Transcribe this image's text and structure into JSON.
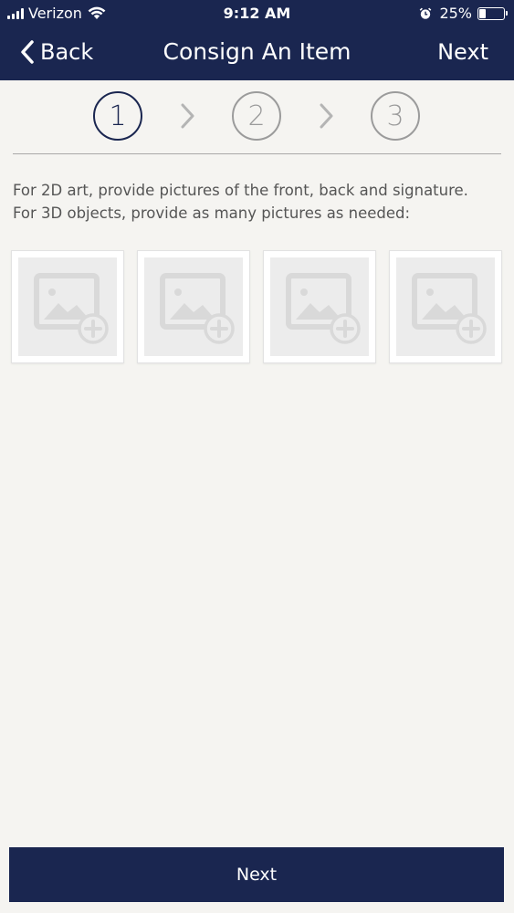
{
  "status_bar": {
    "carrier": "Verizon",
    "time": "9:12 AM",
    "battery_percent": "25%",
    "battery_level": 0.25,
    "icons": [
      "signal-icon",
      "wifi-icon",
      "alarm-icon",
      "battery-icon"
    ]
  },
  "nav": {
    "back_label": "Back",
    "title": "Consign An Item",
    "next_label": "Next"
  },
  "stepper": {
    "steps": [
      "1",
      "2",
      "3"
    ],
    "active_step": 1
  },
  "instructions": {
    "line1": "For 2D art, provide pictures of the front, back and signature.",
    "line2": "For 3D objects, provide as many pictures as needed:"
  },
  "photo_slots": {
    "count": 4,
    "icon": "add-photo-icon"
  },
  "footer": {
    "next_label": "Next"
  },
  "colors": {
    "brand_navy": "#1a2650",
    "background": "#f5f4f1",
    "inactive_gray": "#9b9b9b"
  }
}
